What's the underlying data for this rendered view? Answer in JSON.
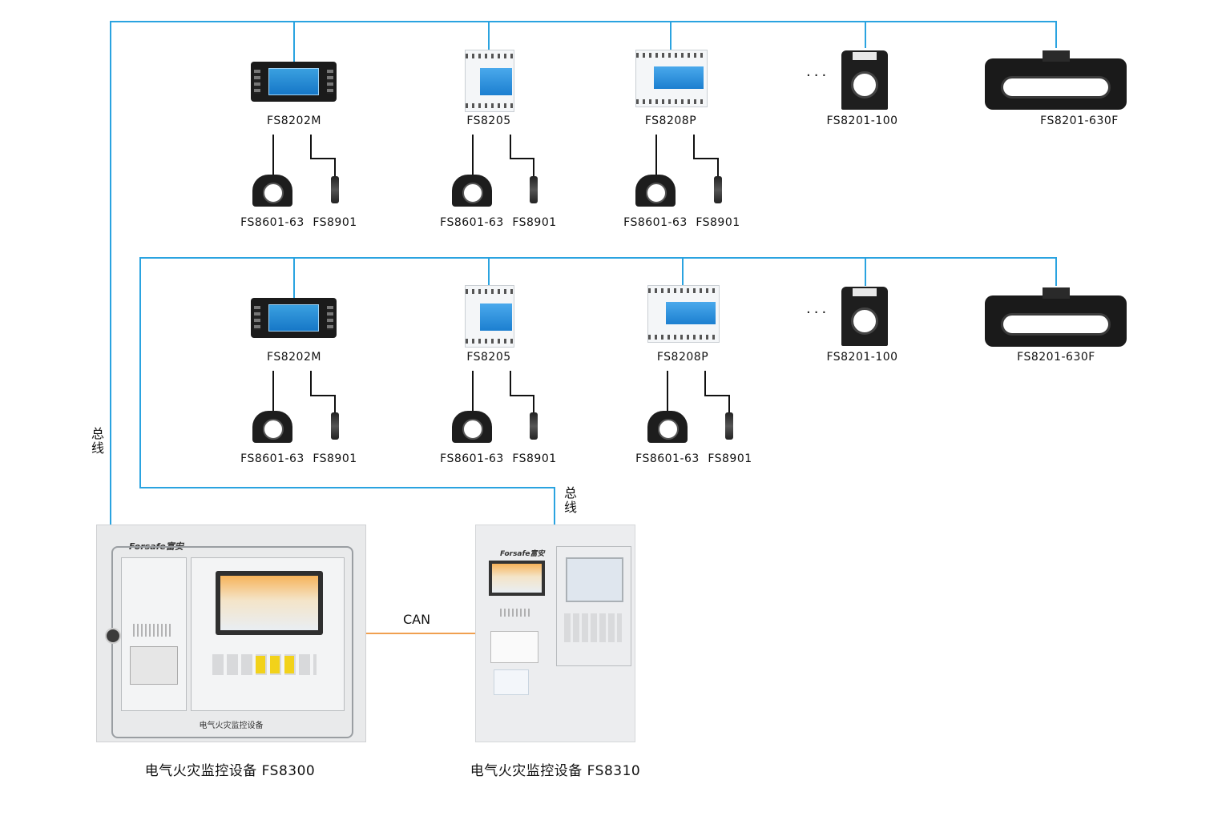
{
  "colors": {
    "bus_line": "#2aa3e0",
    "can_line": "#f0a050"
  },
  "row1": {
    "devices": [
      {
        "model": "FS8202M",
        "kind": "display"
      },
      {
        "model": "FS8205",
        "kind": "module-small"
      },
      {
        "model": "FS8208P",
        "kind": "module-large"
      },
      {
        "model": "FS8201-100",
        "kind": "ct"
      },
      {
        "model": "FS8201-630F",
        "kind": "ct-large"
      }
    ],
    "sensors": [
      {
        "current": "FS8601-63",
        "temp": "FS8901"
      },
      {
        "current": "FS8601-63",
        "temp": "FS8901"
      },
      {
        "current": "FS8601-63",
        "temp": "FS8901"
      }
    ]
  },
  "row2": {
    "devices": [
      {
        "model": "FS8202M",
        "kind": "display"
      },
      {
        "model": "FS8205",
        "kind": "module-small"
      },
      {
        "model": "FS8208P",
        "kind": "module-large"
      },
      {
        "model": "FS8201-100",
        "kind": "ct"
      },
      {
        "model": "FS8201-630F",
        "kind": "ct-large"
      }
    ],
    "sensors": [
      {
        "current": "FS8601-63",
        "temp": "FS8901"
      },
      {
        "current": "FS8601-63",
        "temp": "FS8901"
      },
      {
        "current": "FS8601-63",
        "temp": "FS8901"
      }
    ]
  },
  "ellipsis": "···",
  "bus_label": "总线",
  "can_label": "CAN",
  "main_units": {
    "left": {
      "caption": "电气火灾监控设备  FS8300",
      "brand": "Forsafe富安",
      "panel_text": "电气火灾监控设备"
    },
    "right": {
      "caption": "电气火灾监控设备  FS8310",
      "brand": "Forsafe富安"
    }
  }
}
